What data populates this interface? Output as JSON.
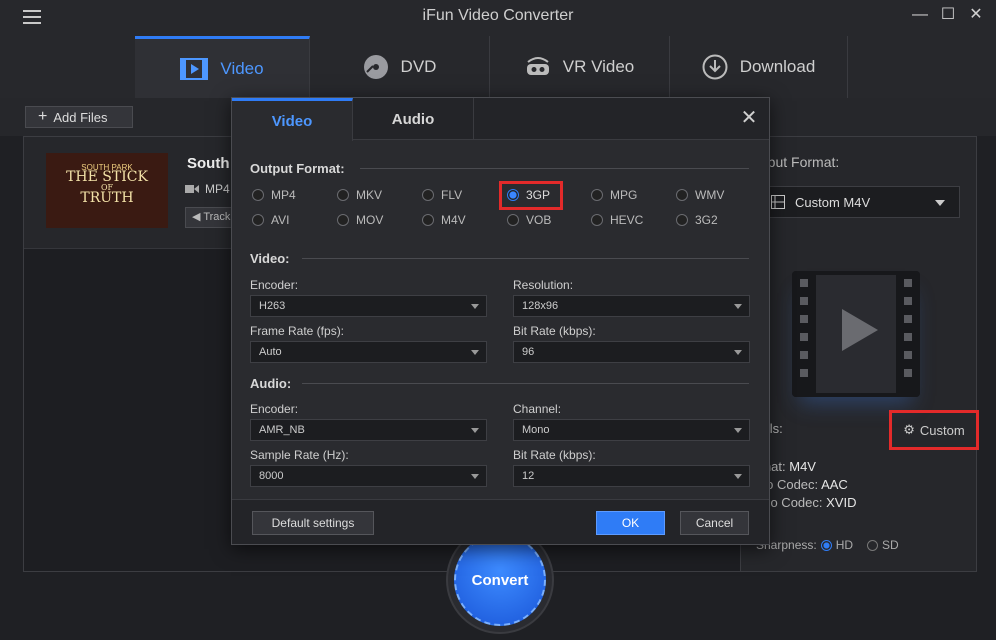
{
  "app": {
    "title": "iFun Video Converter"
  },
  "window": {
    "minimize": "—",
    "maximize": "☐",
    "close": "✕"
  },
  "main_tabs": [
    {
      "label": "Video",
      "icon": "film-icon",
      "active": true
    },
    {
      "label": "DVD",
      "icon": "disc-icon"
    },
    {
      "label": "VR Video",
      "icon": "vr-headset-icon"
    },
    {
      "label": "Download",
      "icon": "download-icon"
    }
  ],
  "toolbar": {
    "add_files": "Add Files"
  },
  "file": {
    "title": "South",
    "format": "MP4",
    "track": "Track",
    "thumb_line1": "SOUTH PARK",
    "thumb_line2": "THE STICK",
    "thumb_line3": "OF",
    "thumb_line4": "TRUTH"
  },
  "right_panel": {
    "output_label": "utput Format:",
    "output_value": "Custom M4V",
    "details_label": "tails:",
    "custom_btn": "Custom",
    "format_label": "rmat:",
    "format_value": "M4V",
    "audio_label": "dio Codec:",
    "audio_value": "AAC",
    "video_label": "deo Codec:",
    "video_value": "XVID",
    "sharpness_label": "Sharpness:",
    "hd": "HD",
    "sd": "SD"
  },
  "convert": {
    "label": "Convert"
  },
  "dialog": {
    "tabs": [
      {
        "label": "Video",
        "active": true
      },
      {
        "label": "Audio"
      }
    ],
    "close": "✕",
    "output_format_head": "Output Format:",
    "formats_row1": [
      "MP4",
      "MKV",
      "FLV",
      "3GP",
      "MPG",
      "WMV"
    ],
    "formats_row2": [
      "AVI",
      "MOV",
      "M4V",
      "VOB",
      "HEVC",
      "3G2"
    ],
    "selected_format": "3GP",
    "video_head": "Video:",
    "audio_head": "Audio:",
    "video": {
      "encoder_label": "Encoder:",
      "encoder": "H263",
      "resolution_label": "Resolution:",
      "resolution": "128x96",
      "framerate_label": "Frame Rate (fps):",
      "framerate": "Auto",
      "bitrate_label": "Bit Rate (kbps):",
      "bitrate": "96"
    },
    "audio": {
      "encoder_label": "Encoder:",
      "encoder": "AMR_NB",
      "channel_label": "Channel:",
      "channel": "Mono",
      "samplerate_label": "Sample Rate (Hz):",
      "samplerate": "8000",
      "bitrate_label": "Bit Rate (kbps):",
      "bitrate": "12"
    },
    "default_btn": "Default settings",
    "ok_btn": "OK",
    "cancel_btn": "Cancel"
  },
  "colors": {
    "accent": "#2f7cf6",
    "highlight": "#e32a2a"
  }
}
